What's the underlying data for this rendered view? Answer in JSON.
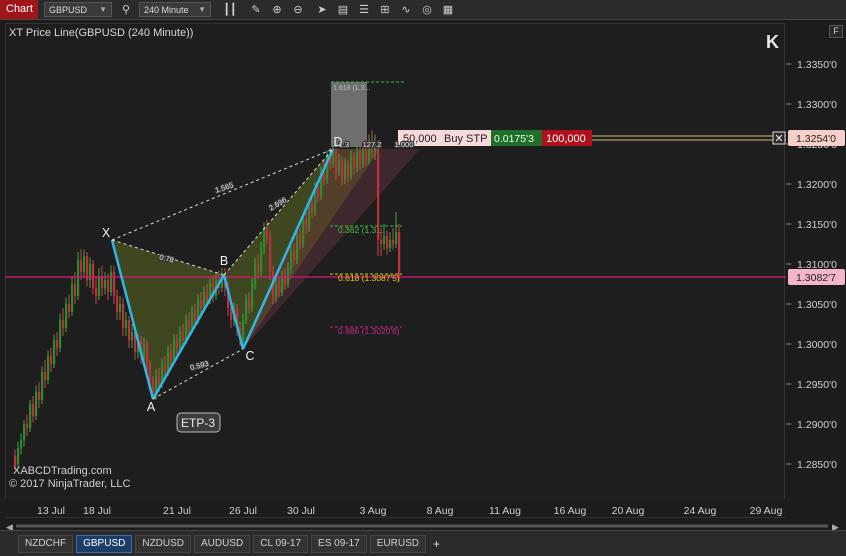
{
  "toolbar": {
    "chart_tab": "Chart",
    "instrument": "GBPUSD",
    "interval": "240 Minute"
  },
  "indicator_label": "XT Price Line(GBPUSD (240 Minute))",
  "panel_button": "F",
  "watermark": {
    "line1": "XABCDTrading.com",
    "line2": "© 2017 NinjaTrader, LLC"
  },
  "price_axis": {
    "ticks": [
      "1.3350'0",
      "1.3300'0",
      "1.3250'0",
      "1.3200'0",
      "1.3150'0",
      "1.3100'0",
      "1.3050'0",
      "1.3000'0",
      "1.2950'0",
      "1.2900'0",
      "1.2850'0"
    ],
    "current_price": "1.3082'7",
    "order_price": "1.3254'0"
  },
  "time_axis": {
    "ticks": [
      "13 Jul",
      "18 Jul",
      "21 Jul",
      "26 Jul",
      "30 Jul",
      "3 Aug",
      "8 Aug",
      "11 Aug",
      "16 Aug",
      "20 Aug",
      "24 Aug",
      "29 Aug"
    ]
  },
  "order": {
    "qty_label": "50,000",
    "type_label": "Buy STP",
    "pnl": "0.0175'3",
    "amount": "100,000"
  },
  "pattern": {
    "points": [
      "X",
      "A",
      "B",
      "C",
      "D"
    ],
    "name": "ETP-3",
    "ratios": {
      "xb": "0.78",
      "ac": "0.593",
      "bd": "2.696",
      "xd": "1.565",
      "top_box": "1.618 (1.3...",
      "d_label1": "1.3",
      "d_label2": "127.2",
      "d_label3": "1.000"
    },
    "fib_levels": [
      {
        "label": "0.382 (1.3...",
        "color": "#3fbf3f"
      },
      {
        "label": "0.618 (1.3087'5)",
        "color": "#e0d020"
      },
      {
        "label": "0.886 (1.3020'6)",
        "color": "#c0307a"
      }
    ]
  },
  "tabs": [
    "NZDCHF",
    "GBPUSD",
    "NZDUSD",
    "AUDUSD",
    "CL 09-17",
    "ES 09-17",
    "EURUSD"
  ],
  "active_tab": "GBPUSD",
  "add_tab_label": "+",
  "colors": {
    "accent": "#a0151a",
    "bull_candle": "#2e8b2e",
    "bear_candle": "#c0303a",
    "price_line": "#e0147a",
    "pattern_leg": "#2fb7e8"
  }
}
